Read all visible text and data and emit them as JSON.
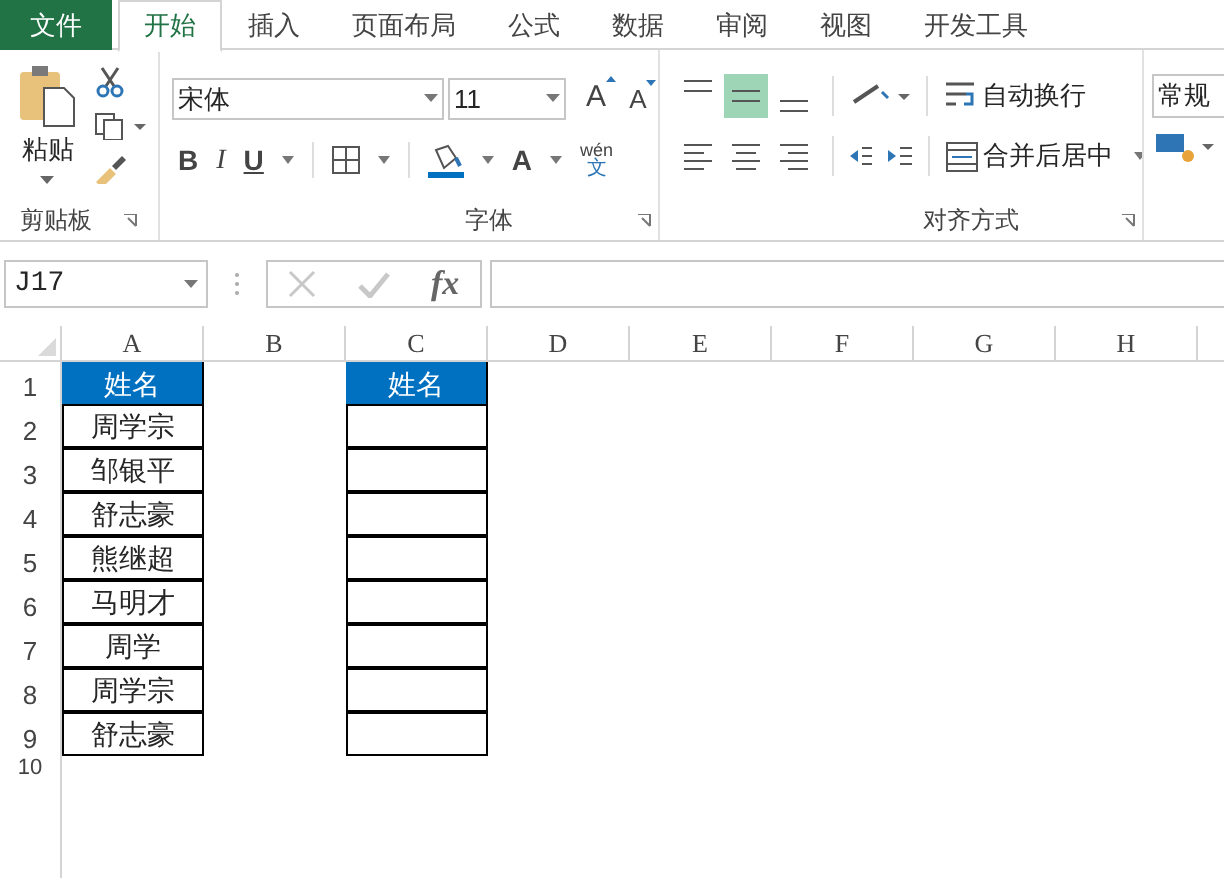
{
  "tabs": [
    {
      "label": "文件",
      "kind": "file",
      "selected": false
    },
    {
      "label": "开始",
      "kind": "tab",
      "selected": true
    },
    {
      "label": "插入",
      "kind": "tab",
      "selected": false
    },
    {
      "label": "页面布局",
      "kind": "tab",
      "selected": false
    },
    {
      "label": "公式",
      "kind": "tab",
      "selected": false
    },
    {
      "label": "数据",
      "kind": "tab",
      "selected": false
    },
    {
      "label": "审阅",
      "kind": "tab",
      "selected": false
    },
    {
      "label": "视图",
      "kind": "tab",
      "selected": false
    },
    {
      "label": "开发工具",
      "kind": "tab",
      "selected": false
    }
  ],
  "clipboard": {
    "paste": "粘贴",
    "label": "剪贴板"
  },
  "font": {
    "name": "宋体",
    "size": "11",
    "grow": "A",
    "shrink": "A",
    "bold": "B",
    "italic": "I",
    "underline": "U",
    "color_letter": "A",
    "phonetic_top": "wén",
    "phonetic_bottom": "文",
    "label": "字体"
  },
  "alignment": {
    "vertical": [
      {
        "kind": "top",
        "selected": false
      },
      {
        "kind": "middle",
        "selected": true
      },
      {
        "kind": "bottom",
        "selected": false
      }
    ],
    "horizontal": [
      {
        "kind": "left",
        "selected": false
      },
      {
        "kind": "center",
        "selected": false
      },
      {
        "kind": "right",
        "selected": false
      }
    ],
    "wrap": "自动换行",
    "merge": "合并后居中",
    "label": "对齐方式"
  },
  "number": {
    "format": "常规"
  },
  "formula_bar": {
    "name_box": "J17",
    "fx": "fx"
  },
  "columns": [
    "A",
    "B",
    "C",
    "D",
    "E",
    "F",
    "G",
    "H"
  ],
  "rows": [
    {
      "number": "1",
      "cells": [
        {
          "text": "姓名",
          "kind": "header"
        },
        {
          "kind": "blank"
        },
        {
          "text": "姓名",
          "kind": "header"
        }
      ]
    },
    {
      "number": "2",
      "cells": [
        {
          "text": "周学宗",
          "kind": "bordered"
        },
        {
          "kind": "blank"
        },
        {
          "kind": "bordered"
        }
      ]
    },
    {
      "number": "3",
      "cells": [
        {
          "text": "邹银平",
          "kind": "bordered"
        },
        {
          "kind": "blank"
        },
        {
          "kind": "bordered"
        }
      ]
    },
    {
      "number": "4",
      "cells": [
        {
          "text": "舒志豪",
          "kind": "bordered"
        },
        {
          "kind": "blank"
        },
        {
          "kind": "bordered"
        }
      ]
    },
    {
      "number": "5",
      "cells": [
        {
          "text": "熊继超",
          "kind": "bordered"
        },
        {
          "kind": "blank"
        },
        {
          "kind": "bordered"
        }
      ]
    },
    {
      "number": "6",
      "cells": [
        {
          "text": "马明才",
          "kind": "bordered"
        },
        {
          "kind": "blank"
        },
        {
          "kind": "bordered"
        }
      ]
    },
    {
      "number": "7",
      "cells": [
        {
          "text": "周学",
          "kind": "bordered"
        },
        {
          "kind": "blank"
        },
        {
          "kind": "bordered"
        }
      ]
    },
    {
      "number": "8",
      "cells": [
        {
          "text": "周学宗",
          "kind": "bordered"
        },
        {
          "kind": "blank"
        },
        {
          "kind": "bordered"
        }
      ]
    },
    {
      "number": "9",
      "cells": [
        {
          "text": "舒志豪",
          "kind": "bordered"
        },
        {
          "kind": "blank"
        },
        {
          "kind": "bordered"
        }
      ]
    },
    {
      "number": "10",
      "cells": []
    }
  ]
}
